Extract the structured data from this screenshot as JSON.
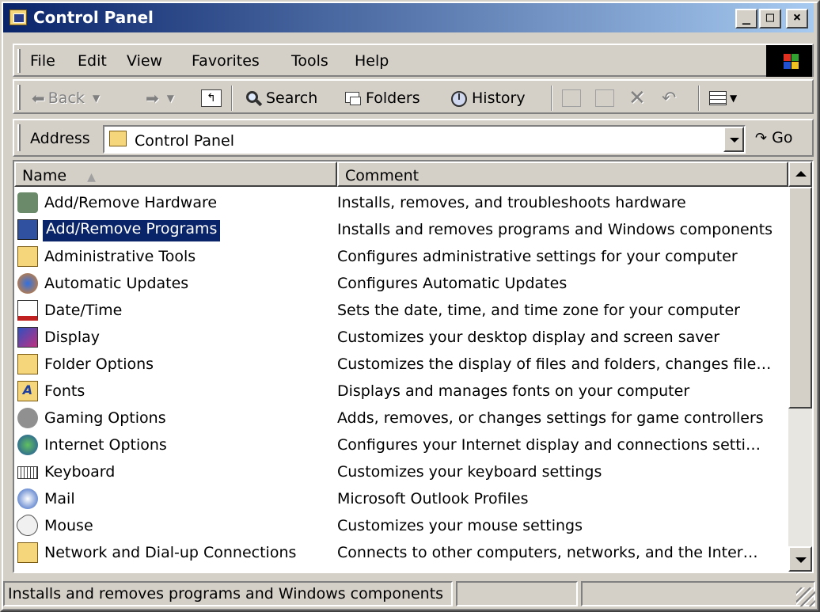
{
  "window": {
    "title": "Control Panel"
  },
  "title_buttons": {
    "minimize": "_",
    "maximize": "□",
    "close": "×"
  },
  "menu": [
    {
      "label": "File"
    },
    {
      "label": "Edit"
    },
    {
      "label": "View"
    },
    {
      "label": "Favorites"
    },
    {
      "label": "Tools"
    },
    {
      "label": "Help"
    }
  ],
  "toolbar": {
    "back": "Back",
    "search": "Search",
    "folders": "Folders",
    "history": "History"
  },
  "address": {
    "label": "Address",
    "value": "Control Panel",
    "go": "Go"
  },
  "columns": {
    "name": "Name",
    "comment": "Comment"
  },
  "items": [
    {
      "name": "Add/Remove Hardware",
      "comment": "Installs, removes, and troubleshoots hardware",
      "icon": "hardware-icon"
    },
    {
      "name": "Add/Remove Programs",
      "comment": "Installs and removes programs and Windows components",
      "icon": "programs-icon",
      "selected": true
    },
    {
      "name": "Administrative Tools",
      "comment": "Configures administrative settings for your computer",
      "icon": "admin-tools-icon"
    },
    {
      "name": "Automatic Updates",
      "comment": "Configures Automatic Updates",
      "icon": "updates-icon"
    },
    {
      "name": "Date/Time",
      "comment": "Sets the date, time, and time zone for your computer",
      "icon": "date-time-icon"
    },
    {
      "name": "Display",
      "comment": "Customizes your desktop display and screen saver",
      "icon": "display-icon"
    },
    {
      "name": "Folder Options",
      "comment": "Customizes the display of files and folders, changes file…",
      "icon": "folder-options-icon"
    },
    {
      "name": "Fonts",
      "comment": "Displays and manages fonts on your computer",
      "icon": "fonts-icon"
    },
    {
      "name": "Gaming Options",
      "comment": "Adds, removes, or changes settings for game controllers",
      "icon": "gaming-icon"
    },
    {
      "name": "Internet Options",
      "comment": "Configures your Internet display and connections setti…",
      "icon": "internet-icon"
    },
    {
      "name": "Keyboard",
      "comment": "Customizes your keyboard settings",
      "icon": "keyboard-icon"
    },
    {
      "name": "Mail",
      "comment": "Microsoft Outlook Profiles",
      "icon": "mail-icon"
    },
    {
      "name": "Mouse",
      "comment": "Customizes your mouse settings",
      "icon": "mouse-icon"
    },
    {
      "name": "Network and Dial-up Connections",
      "comment": "Connects to other computers, networks, and the Inter…",
      "icon": "network-icon"
    }
  ],
  "status": {
    "text": "Installs and removes programs and Windows components"
  },
  "colors": {
    "title_start": "#0a246a",
    "title_end": "#a6caf0",
    "selection": "#0a246a",
    "face": "#d4d0c8"
  }
}
